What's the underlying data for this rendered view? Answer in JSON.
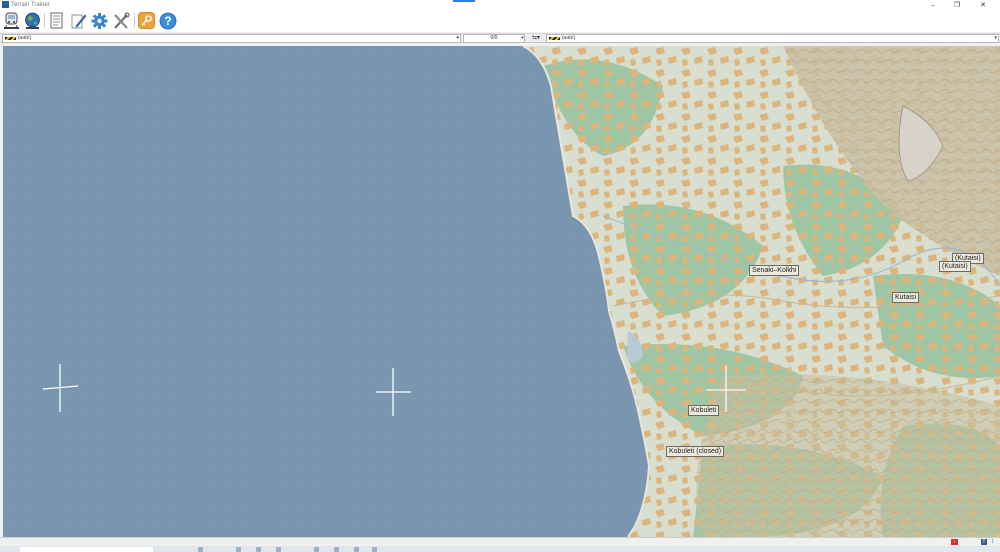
{
  "window": {
    "title": "Terrain Trainer",
    "minimize_glyph": "–",
    "restore_glyph": "❐",
    "close_glyph": "✕"
  },
  "toolbar": {
    "buttons": [
      {
        "name": "train-icon",
        "label": ""
      },
      {
        "name": "globe-icon",
        "label": ""
      },
      {
        "name": "document-icon",
        "label": ""
      },
      {
        "name": "edit-icon",
        "label": ""
      },
      {
        "name": "gear-icon",
        "label": ""
      },
      {
        "name": "tools-icon",
        "label": ""
      },
      {
        "name": "key-icon",
        "label": ""
      },
      {
        "name": "help-icon",
        "label": "?"
      }
    ]
  },
  "selectors": {
    "left_value": "(auto)",
    "middle_value": "0/0",
    "right_value": "(auto)",
    "dropdown_glyph": "▾",
    "swap_glyph": "⇆▾"
  },
  "map": {
    "sea_color": "#7a95b0",
    "land_color": "#d9dfd0",
    "forest_color": "#9fc6a4",
    "farmland_color": "#dcb57c",
    "labels": [
      {
        "text": "Senaki–Kolkhi"
      },
      {
        "text": "(Kutaisi)"
      },
      {
        "text": "(Kutaisi)"
      },
      {
        "text": "Kutaisi"
      },
      {
        "text": "Kobuleti"
      },
      {
        "text": "Kobuleti (closed)"
      }
    ]
  },
  "statusbar": {
    "red_badge": "!",
    "facebook": "f",
    "twitter": "t"
  }
}
